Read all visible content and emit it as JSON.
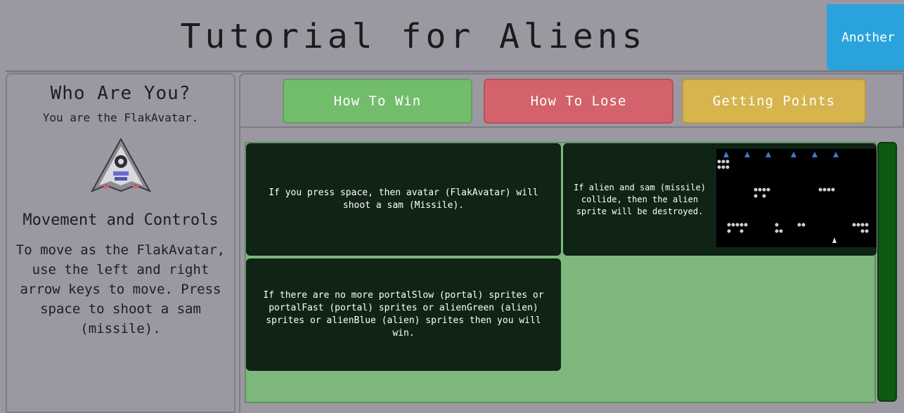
{
  "header": {
    "title": "Tutorial for Aliens",
    "another_label": "Another"
  },
  "sidebar": {
    "who_heading": "Who Are You?",
    "who_text": "You are the FlakAvatar.",
    "avatar_icon": "spaceship-icon",
    "movement_heading": "Movement and Controls",
    "movement_text": "To move as the FlakAvatar, use the left and right arrow keys to move. Press space to shoot a sam (missile)."
  },
  "tabs": {
    "win": "How To Win",
    "lose": "How To Lose",
    "points": "Getting Points"
  },
  "cards": [
    {
      "text": "If you press space, then avatar (FlakAvatar) will shoot a sam (Missile)."
    },
    {
      "text": "If alien and sam (missile) collide, then the alien sprite will be destroyed."
    },
    {
      "text": "If there are no more portalSlow (portal) sprites or portalFast (portal) sprites or alienGreen (alien) sprites or alienBlue (alien) sprites then you will win."
    }
  ],
  "colors": {
    "win": "#72bd6c",
    "lose": "#d4626c",
    "points": "#d6b44e",
    "another": "#2aa3dc",
    "card": "#0f2415"
  }
}
